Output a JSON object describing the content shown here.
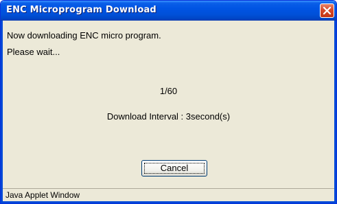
{
  "window": {
    "title": "ENC Microprogram Download",
    "close_icon": "close-icon"
  },
  "content": {
    "message_line1": "Now downloading ENC micro program.",
    "message_line2": "Please wait...",
    "progress_text": "1/60",
    "interval_text": "Download Interval : 3second(s)"
  },
  "buttons": {
    "cancel_label": "Cancel"
  },
  "statusbar": {
    "text": "Java Applet Window"
  },
  "colors": {
    "titlebar": "#0054e3",
    "dialog_bg": "#ece9d8",
    "close_button": "#d7492a"
  }
}
